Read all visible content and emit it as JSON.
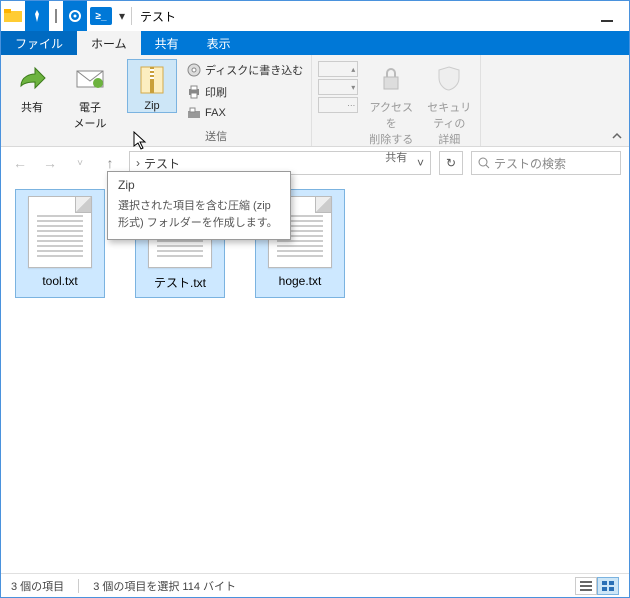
{
  "title": "テスト",
  "tabs": {
    "file": "ファイル",
    "home": "ホーム",
    "share": "共有",
    "view": "表示"
  },
  "ribbon": {
    "bigShare": "共有",
    "email": "電子\nメール",
    "zip": "Zip",
    "burn": "ディスクに書き込む",
    "print": "印刷",
    "fax": "FAX",
    "groupSend": "送信",
    "removeAccess": "アクセスを\n削除する",
    "securityDetails": "セキュリティの\n詳細",
    "groupShare": "共有"
  },
  "tooltip": {
    "title": "Zip",
    "body": "選択された項目を含む圧縮 (zip 形式) フォルダーを作成します。"
  },
  "address": {
    "crumb": "テスト"
  },
  "search": {
    "placeholder": "テストの検索"
  },
  "files": [
    {
      "name": "tool.txt"
    },
    {
      "name": "テスト.txt"
    },
    {
      "name": "hoge.txt"
    }
  ],
  "status": {
    "count": "3 個の項目",
    "selection": "3 個の項目を選択 114 バイト"
  }
}
